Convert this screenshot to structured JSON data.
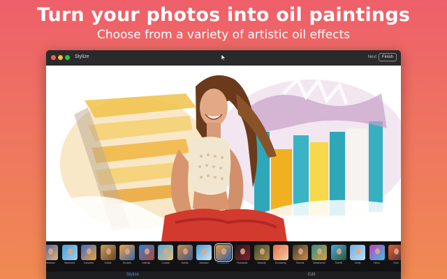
{
  "headline": "Turn your photos into oil paintings",
  "subheadline": "Choose from a variety of artistic oil effects",
  "window": {
    "title": "Stylize",
    "next_label": "Next",
    "finish_label": "Finish"
  },
  "styles": [
    {
      "label": "Abstract",
      "colors": [
        "#3a5ea8",
        "#e8b37a"
      ]
    },
    {
      "label": "Sketched",
      "colors": [
        "#4aa0d8",
        "#9fd0ea"
      ]
    },
    {
      "label": "Colourful",
      "colors": [
        "#3d6bd3",
        "#f0a030"
      ]
    },
    {
      "label": "Subtle",
      "colors": [
        "#c99a5a",
        "#6a4a2e"
      ]
    },
    {
      "label": "Strokes",
      "colors": [
        "#f0a040",
        "#3a6ab0"
      ]
    },
    {
      "label": "Intense",
      "colors": [
        "#2f7fd1",
        "#b04a3a"
      ]
    },
    {
      "label": "Cordial",
      "colors": [
        "#5aa5d8",
        "#e0c080"
      ]
    },
    {
      "label": "Gentle",
      "colors": [
        "#c58a4a",
        "#3d5a8a"
      ]
    },
    {
      "label": "Abstract",
      "colors": [
        "#4a9cd8",
        "#cfe4f2"
      ]
    },
    {
      "label": "Enhanced",
      "colors": [
        "#e6963a",
        "#2e66b6"
      ]
    },
    {
      "label": "Romantic",
      "colors": [
        "#1a1a1a",
        "#8a2030"
      ]
    },
    {
      "label": "Velocity",
      "colors": [
        "#3a4a2a",
        "#b08a4a"
      ]
    },
    {
      "label": "Drunkenly",
      "colors": [
        "#e86a4a",
        "#f4d0a0"
      ]
    },
    {
      "label": "Surreal",
      "colors": [
        "#3a3a3a",
        "#d09040"
      ]
    },
    {
      "label": "Weathered",
      "colors": [
        "#2a8a8a",
        "#e0a040"
      ]
    },
    {
      "label": "Sheriff",
      "colors": [
        "#4aa8e0",
        "#2a5a3a"
      ]
    },
    {
      "label": "Chilly",
      "colors": [
        "#6ab0e8",
        "#c0e0f0"
      ]
    },
    {
      "label": "Neon",
      "colors": [
        "#c040c0",
        "#40c0e0"
      ]
    },
    {
      "label": "Sunr",
      "colors": [
        "#e06030",
        "#503040"
      ]
    }
  ],
  "selected_style_index": 9,
  "tabs": [
    {
      "label": "Stylize",
      "active": true
    },
    {
      "label": "Edit",
      "active": false
    }
  ]
}
